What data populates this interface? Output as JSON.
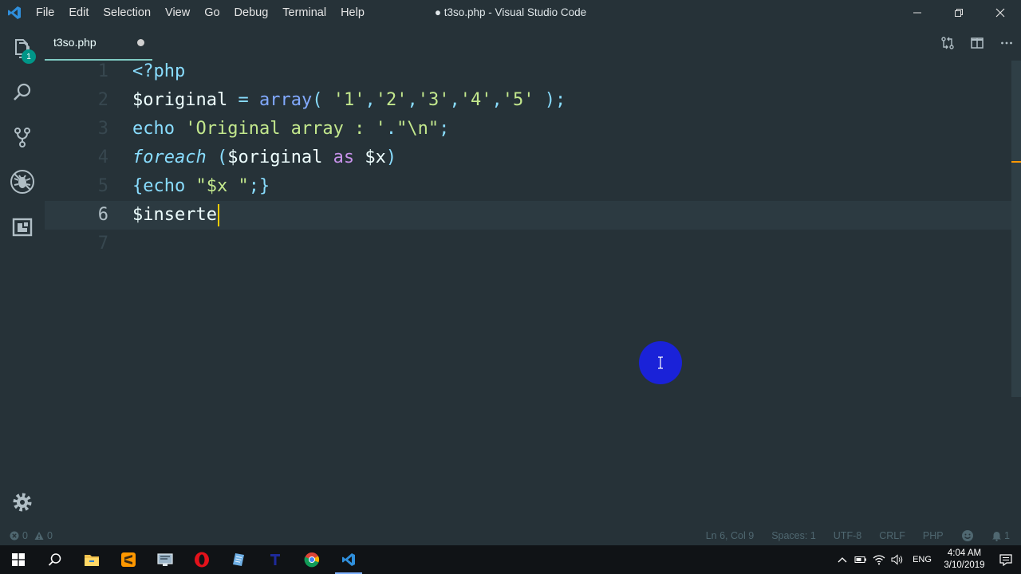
{
  "window": {
    "title": "● t3so.php - Visual Studio Code"
  },
  "menu": [
    "File",
    "Edit",
    "Selection",
    "View",
    "Go",
    "Debug",
    "Terminal",
    "Help"
  ],
  "activity_bar": {
    "explorer_badge": "1"
  },
  "tab": {
    "label": "t3so.php"
  },
  "editor": {
    "line_numbers": [
      "1",
      "2",
      "3",
      "4",
      "5",
      "6",
      "7"
    ],
    "current_line": 6,
    "lines": [
      [
        {
          "t": "<?php",
          "c": "op"
        }
      ],
      [
        {
          "t": "$original",
          "c": "v"
        },
        {
          "t": " = ",
          "c": "op"
        },
        {
          "t": "array",
          "c": "fn"
        },
        {
          "t": "( ",
          "c": "p"
        },
        {
          "t": "'1'",
          "c": "str"
        },
        {
          "t": ",",
          "c": "p"
        },
        {
          "t": "'2'",
          "c": "str"
        },
        {
          "t": ",",
          "c": "p"
        },
        {
          "t": "'3'",
          "c": "str"
        },
        {
          "t": ",",
          "c": "p"
        },
        {
          "t": "'4'",
          "c": "str"
        },
        {
          "t": ",",
          "c": "p"
        },
        {
          "t": "'5'",
          "c": "str"
        },
        {
          "t": " );",
          "c": "p"
        }
      ],
      [
        {
          "t": "echo",
          "c": "kw"
        },
        {
          "t": " ",
          "c": "v"
        },
        {
          "t": "'Original array : '",
          "c": "str"
        },
        {
          "t": ".",
          "c": "op"
        },
        {
          "t": "\"\\n\"",
          "c": "str"
        },
        {
          "t": ";",
          "c": "p"
        }
      ],
      [
        {
          "t": "foreach",
          "c": "kwi"
        },
        {
          "t": " (",
          "c": "p"
        },
        {
          "t": "$original",
          "c": "v"
        },
        {
          "t": " as ",
          "c": "as"
        },
        {
          "t": "$x",
          "c": "v"
        },
        {
          "t": ")",
          "c": "p"
        }
      ],
      [
        {
          "t": "{",
          "c": "p"
        },
        {
          "t": "echo",
          "c": "kw"
        },
        {
          "t": " ",
          "c": "v"
        },
        {
          "t": "\"$x \"",
          "c": "str"
        },
        {
          "t": ";}",
          "c": "p"
        }
      ],
      [
        {
          "t": "$inserte",
          "c": "v"
        }
      ],
      []
    ]
  },
  "statusbar": {
    "errors": "0",
    "warnings": "0",
    "position": "Ln 6, Col 9",
    "spaces": "Spaces: 1",
    "encoding": "UTF-8",
    "eol": "CRLF",
    "language": "PHP",
    "notifications": "1"
  },
  "taskbar": {
    "lang": "ENG",
    "time": "4:04 AM",
    "date": "3/10/2019"
  },
  "colors": {
    "background": "#263238",
    "accent": "#80cbc4",
    "cursor": "#ffcc00",
    "click_indicator": "#1a22d8"
  }
}
